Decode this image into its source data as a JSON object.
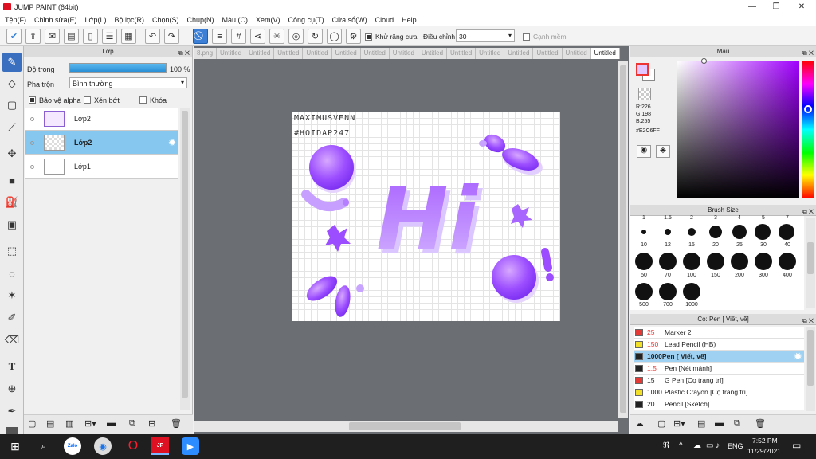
{
  "window": {
    "title": "JUMP PAINT (64bit)"
  },
  "menu": [
    "Tệp(F)",
    "Chỉnh sửa(E)",
    "Lớp(L)",
    "Bộ lọc(R)",
    "Chọn(S)",
    "Chụp(N)",
    "Màu (C)",
    "Xem(V)",
    "Công cụ(T)",
    "Cửa sổ(W)",
    "Cloud",
    "Help"
  ],
  "toolbar": {
    "antialias_label": "Khử răng cưa",
    "adjust_label": "Điều chỉnh",
    "adjust_value": "30",
    "snap_label": "Cạnh mềm"
  },
  "layer_panel": {
    "title": "Lớp",
    "opacity_label": "Độ trong",
    "opacity_value": "100 %",
    "opacity_fraction": 1.0,
    "blend_label": "Pha trộn",
    "blend_value": "Bình thường",
    "protect_alpha": "Bảo vệ alpha",
    "clip": "Xén bớt",
    "lock": "Khóa",
    "layers": [
      {
        "name": "Lớp2",
        "selected": false
      },
      {
        "name": "Lớp2",
        "selected": true
      },
      {
        "name": "Lớp1",
        "selected": false
      }
    ]
  },
  "tabs": [
    "8.png",
    "Untitled",
    "Untitled",
    "Untitled",
    "Untitled",
    "Untitled",
    "Untitled",
    "Untitled",
    "Untitled",
    "Untitled",
    "Untitled",
    "Untitled",
    "Untitled",
    "Untitled",
    "Untitled"
  ],
  "canvas": {
    "watermark_line1": "MAXIMUSVENN",
    "watermark_line2": "#HOIDAP247",
    "big_text": "Hi",
    "accent": "#9b4dff"
  },
  "color_panel": {
    "title": "Màu",
    "r": "R:226",
    "g": "G:198",
    "b": "B:255",
    "hex": "#E2C6FF",
    "swatch": "#E2C6FF"
  },
  "brush_size": {
    "title": "Brush Size",
    "top_labels": [
      "1",
      "1.5",
      "2",
      "3",
      "4",
      "5",
      "7"
    ],
    "rows": [
      [
        "10",
        "12",
        "15",
        "20",
        "25",
        "30",
        "40"
      ],
      [
        "50",
        "70",
        "100",
        "150",
        "200",
        "300",
        "400"
      ],
      [
        "500",
        "700",
        "1000"
      ]
    ]
  },
  "brush_list": {
    "title": "Cọ: Pen [ Viết, vẽ]",
    "items": [
      {
        "size": "25",
        "name": "Marker 2",
        "color": "#e53935",
        "size_color": "#e53935"
      },
      {
        "size": "150",
        "name": "Lead Pencil (HB)",
        "color": "#f1e027",
        "size_color": "#e53935"
      },
      {
        "size": "1000",
        "name": "Pen [ Viết, vẽ]",
        "color": "#222222",
        "size_color": "#111111",
        "selected": true
      },
      {
        "size": "1.5",
        "name": "Pen [Nét mảnh]",
        "color": "#222222",
        "size_color": "#e53935"
      },
      {
        "size": "15",
        "name": "G Pen [Cọ trang trí]",
        "color": "#e53935",
        "size_color": "#111111"
      },
      {
        "size": "1000",
        "name": "Plastic Crayon [Cọ trang trí]",
        "color": "#f1e027",
        "size_color": "#111111"
      },
      {
        "size": "20",
        "name": "Pencil [Sketch]",
        "color": "#222222",
        "size_color": "#111111"
      }
    ]
  },
  "taskbar": {
    "lang": "ENG",
    "time": "7:52 PM",
    "date": "11/29/2021"
  }
}
